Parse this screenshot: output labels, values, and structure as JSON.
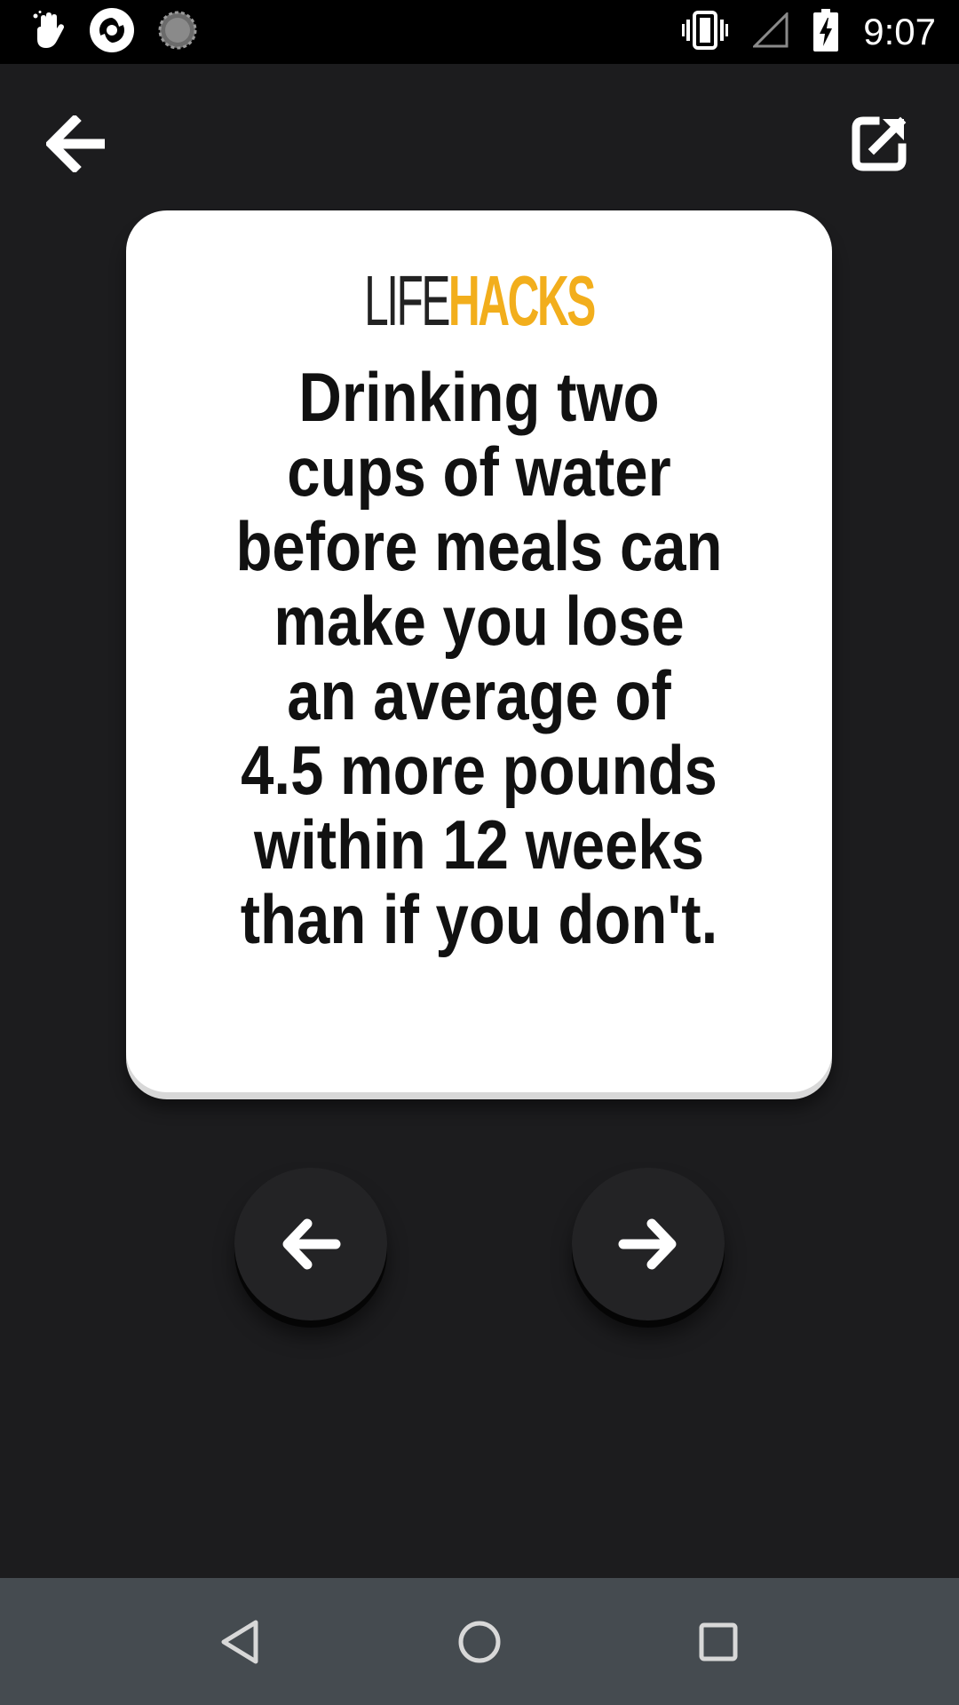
{
  "status_bar": {
    "time": "9:07",
    "icons": [
      "hand-wave-icon",
      "camera-shutter-icon",
      "spinner-icon",
      "vibrate-icon",
      "signal-icon",
      "battery-charging-icon"
    ]
  },
  "toolbar": {
    "back_icon": "arrow-left-icon",
    "share_icon": "share-external-icon"
  },
  "card": {
    "brand_first": "LIFE",
    "brand_second": "HACKS",
    "brand_second_color": "#f2ae1c",
    "fact": "Drinking two\ncups of water\nbefore meals can\nmake you lose\nan average of\n4.5 more pounds\nwithin 12 weeks\nthan if you don't."
  },
  "navigation": {
    "previous_icon": "arrow-left-icon",
    "next_icon": "arrow-right-icon"
  },
  "system_nav": {
    "icons": [
      "back-triangle-icon",
      "home-circle-icon",
      "recents-square-icon"
    ]
  }
}
